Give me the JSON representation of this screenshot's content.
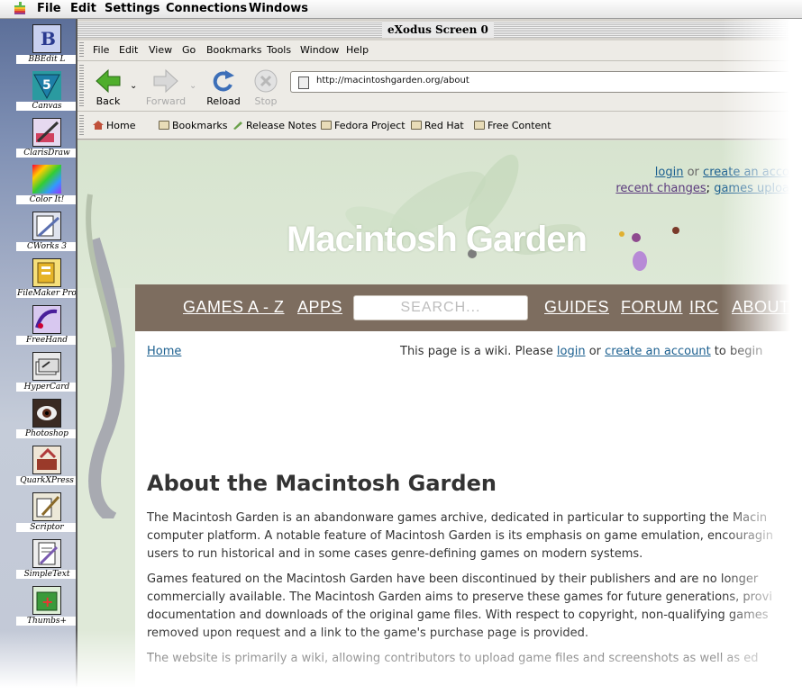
{
  "menubar": {
    "items": [
      "File",
      "Edit",
      "Settings",
      "Connections",
      "Windows"
    ]
  },
  "desktop": {
    "icons": [
      {
        "label": "BBEdit L",
        "icon": "bbedit-icon",
        "color": "#3a4fa0"
      },
      {
        "label": "Canvas",
        "icon": "canvas-icon",
        "color": "#2a9aa0"
      },
      {
        "label": "ClarisDraw",
        "icon": "clarisdraw-icon",
        "color": "#7a4fb0"
      },
      {
        "label": "Color It!",
        "icon": "colorit-icon",
        "color": "#c04a2a"
      },
      {
        "label": "CWorks 3",
        "icon": "clarisworks-icon",
        "color": "#5a6fb0"
      },
      {
        "label": "FileMaker Pro",
        "icon": "filemaker-icon",
        "color": "#d9b23a"
      },
      {
        "label": "FreeHand",
        "icon": "freehand-icon",
        "color": "#6a3fb0"
      },
      {
        "label": "HyperCard",
        "icon": "hypercard-icon",
        "color": "#6a6a6a"
      },
      {
        "label": "Photoshop",
        "icon": "photoshop-icon",
        "color": "#8a2a2a"
      },
      {
        "label": "QuarkXPress",
        "icon": "quarkxpress-icon",
        "color": "#b03a3a"
      },
      {
        "label": "Scriptor",
        "icon": "scriptor-icon",
        "color": "#8a8a5a"
      },
      {
        "label": "SimpleText",
        "icon": "simpletext-icon",
        "color": "#7a5ab0"
      },
      {
        "label": "Thumbs+",
        "icon": "thumbsplus-icon",
        "color": "#3a9a3a"
      }
    ]
  },
  "window": {
    "title": "eXodus Screen 0"
  },
  "browser": {
    "menus": [
      "File",
      "Edit",
      "View",
      "Go",
      "Bookmarks",
      "Tools",
      "Window",
      "Help"
    ],
    "nav": {
      "back": "Back",
      "forward": "Forward",
      "reload": "Reload",
      "stop": "Stop"
    },
    "url": "http://macintoshgarden.org/about",
    "bookmarks": [
      "Home",
      "Bookmarks",
      "Release Notes",
      "Fedora Project",
      "Red Hat",
      "Free Content"
    ]
  },
  "site": {
    "toplinks": {
      "login": "login",
      "or": "or",
      "create": "create an acco",
      "recent": "recent changes",
      "games": "games uploa"
    },
    "logo": "Macintosh Garden",
    "nav": {
      "games": "GAMES A - Z",
      "apps": "APPS",
      "search_placeholder": "SEARCH...",
      "guides": "GUIDES",
      "forum": "FORUM",
      "irc": "IRC",
      "about": "ABOUT"
    },
    "breadcrumb": "Home",
    "wikinote": {
      "pre": "This page is a wiki. Please ",
      "login": "login",
      "or": " or ",
      "create": "create an account",
      "post": " to begin"
    },
    "heading": "About the Macintosh Garden",
    "paragraphs": [
      "The Macintosh Garden is an abandonware games archive, dedicated in particular to supporting the Macin\ncomputer platform. A notable feature of Macintosh Garden is its emphasis on game emulation, encouragin\nusers to run historical and in some cases genre-defining games on modern systems.",
      "Games featured on the Macintosh Garden have been discontinued by their publishers and are no longer\ncommercially available. The Macintosh Garden aims to preserve these games for future generations, provi\ndocumentation and downloads of the original game files. With respect to copyright, non-qualifying games\nremoved upon request and a link to the game's purchase page is provided.",
      "The website is primarily a wiki, allowing contributors to upload game files and screenshots as well as ed"
    ]
  }
}
